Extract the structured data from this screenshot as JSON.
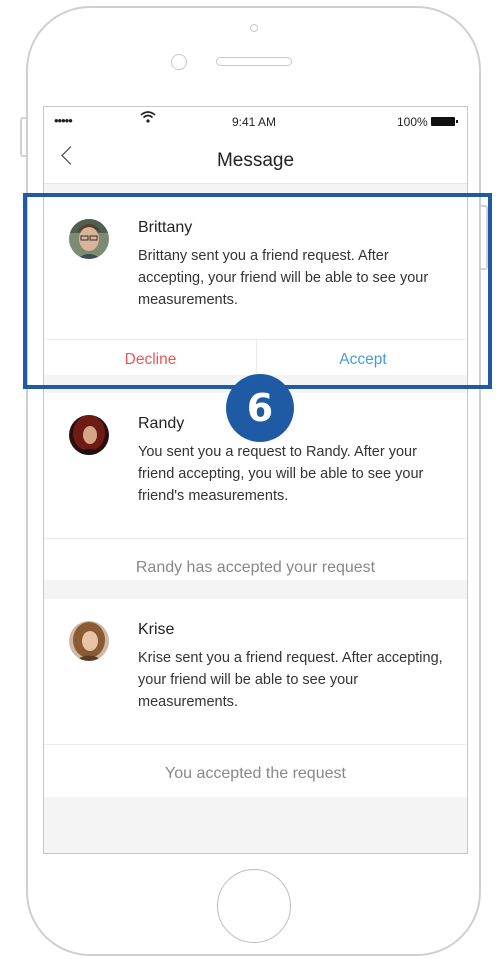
{
  "status_bar": {
    "signal": "•••••",
    "time": "9:41 AM",
    "battery": "100%"
  },
  "header": {
    "title": "Message"
  },
  "messages": [
    {
      "name": "Brittany",
      "text": "Brittany sent you a friend request. After accepting, your friend will be able to see your measurements.",
      "decline_label": "Decline",
      "accept_label": "Accept"
    },
    {
      "name": "Randy",
      "text": "You sent you a request to Randy. After your friend accepting, you will be able to see your friend's measurements.",
      "status": "Randy has accepted your request"
    },
    {
      "name": "Krise",
      "text": "Krise sent you a friend request. After accepting, your friend will be able to see your measurements.",
      "status": "You accepted the request"
    }
  ],
  "annotation": {
    "step_number": "6",
    "color": "#1f5ba5"
  },
  "colors": {
    "decline": "#e35757",
    "accept": "#4a9ad8"
  }
}
